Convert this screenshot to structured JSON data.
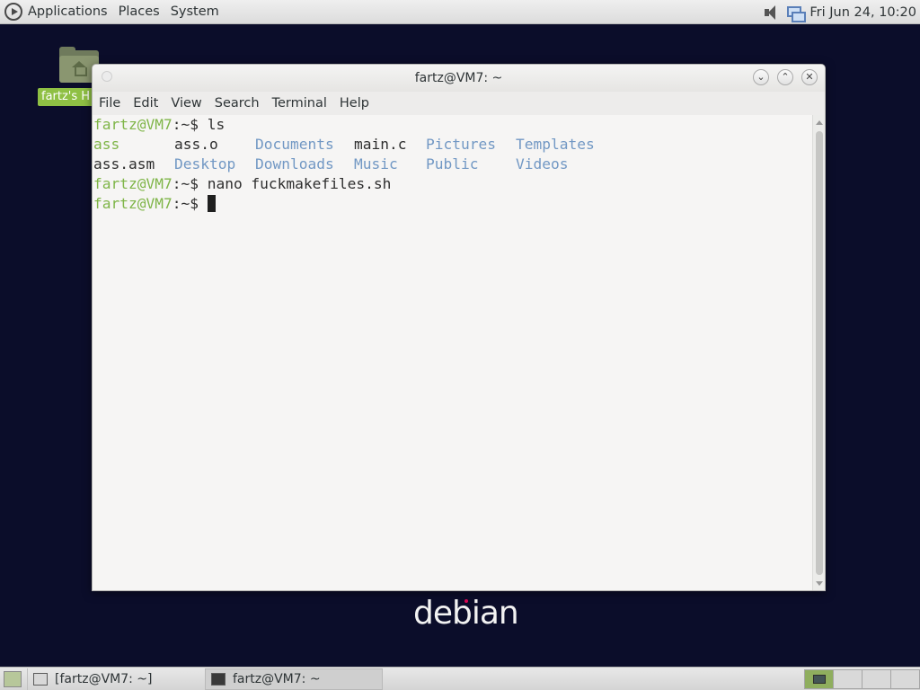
{
  "top_panel": {
    "menus": [
      "Applications",
      "Places",
      "System"
    ],
    "clock": "Fri Jun 24, 10:20",
    "tray_icons": [
      "volume-icon",
      "network-icon"
    ]
  },
  "desktop": {
    "home_icon_label": "fartz's H",
    "logo_text": "debian"
  },
  "terminal": {
    "title": "fartz@VM7: ~",
    "menus": [
      "File",
      "Edit",
      "View",
      "Search",
      "Terminal",
      "Help"
    ],
    "prompt_user": "fartz@VM7",
    "prompt_path": ":~$ ",
    "command_1": "ls",
    "ls_row_1": [
      "ass",
      "ass.o",
      "Documents",
      "main.c",
      "Pictures",
      "Templates"
    ],
    "ls_row_2": [
      "ass.asm",
      "Desktop",
      "Downloads",
      "Music",
      "Public",
      "Videos"
    ],
    "command_2": "nano fuckmakefiles.sh",
    "colors": {
      "prompt": "#7fb548",
      "directory": "#7298c4",
      "executable": "#7fb548",
      "text": "#2e2e2e"
    }
  },
  "taskbar": {
    "tasks": [
      "[fartz@VM7: ~]",
      "fartz@VM7: ~"
    ]
  }
}
